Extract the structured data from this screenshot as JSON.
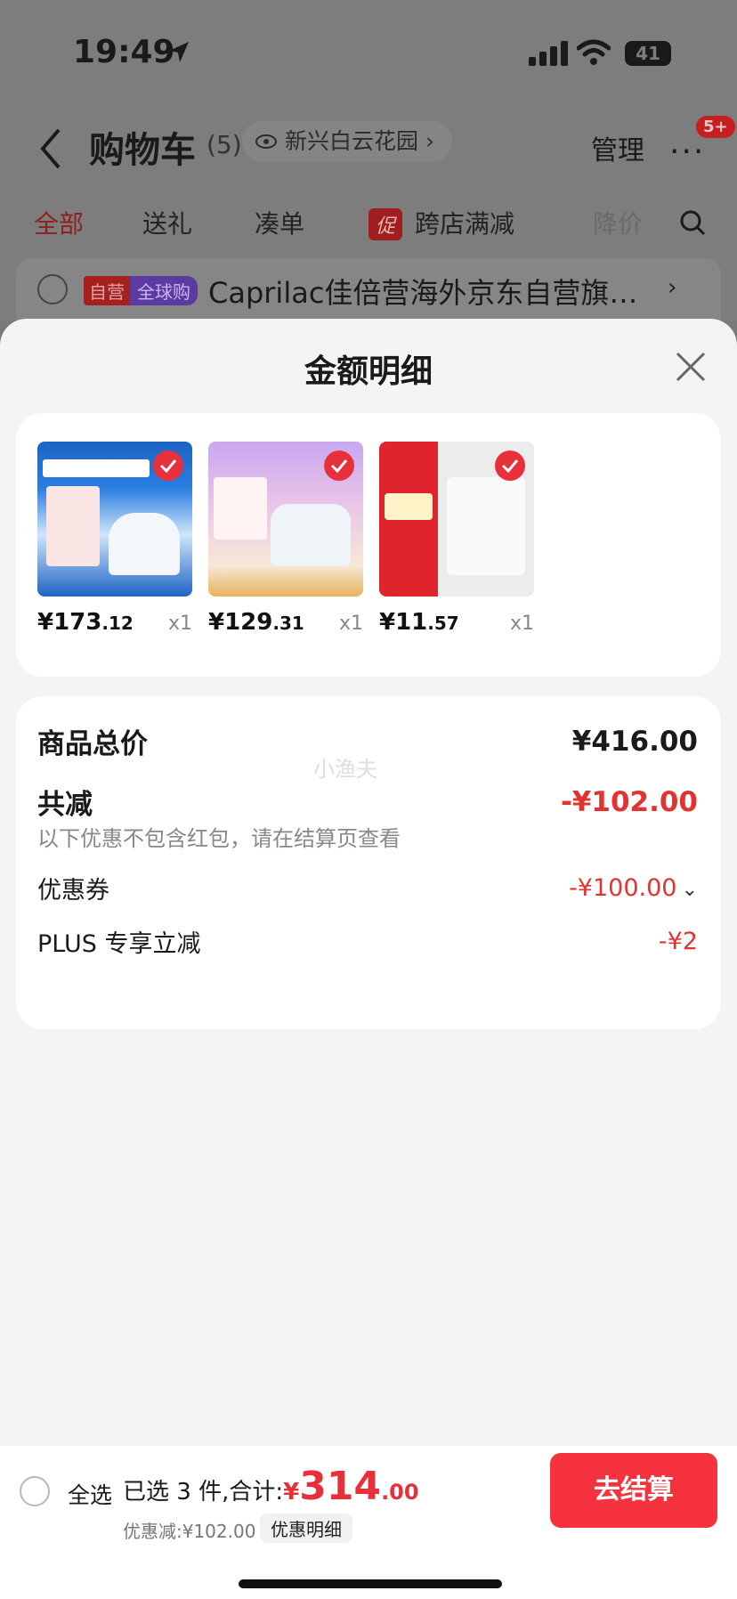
{
  "status_bar": {
    "time": "19:49",
    "battery": "41"
  },
  "header": {
    "title": "购物车",
    "count": "(5)",
    "address": "新兴白云花园",
    "manage": "管理",
    "more": "···",
    "badge": "5+"
  },
  "tabs": [
    "全部",
    "送礼",
    "凑单",
    "跨店满减",
    "降价"
  ],
  "promo_tag": "促",
  "shop": {
    "tag_self": "自营",
    "tag_global": "全球购",
    "name": "Caprilac佳倍营海外京东自营旗…",
    "chevron": "›"
  },
  "sheet": {
    "title": "金额明细",
    "products": [
      {
        "price_int": "¥173",
        "price_dec": ".12",
        "qty": "x1"
      },
      {
        "price_int": "¥129",
        "price_dec": ".31",
        "qty": "x1"
      },
      {
        "price_int": "¥11",
        "price_dec": ".57",
        "qty": "x1"
      }
    ],
    "detail": {
      "subtotal_label": "商品总价",
      "subtotal_value": "¥416.00",
      "watermark": "小渔夫",
      "reduce_label": "共减",
      "reduce_value": "-¥102.00",
      "note": "以下优惠不包含红包，请在结算页查看",
      "coupon_label": "优惠券",
      "coupon_value": "-¥100.00",
      "plus_label": "PLUS 专享立减",
      "plus_value": "-¥2"
    }
  },
  "bottom": {
    "select_all": "全选",
    "summary_label": "已选 3 件,合计:",
    "total_symbol": "¥",
    "total_int": "314",
    "total_dec": ".00",
    "discount_text": "优惠减:¥102.00",
    "discount_button": "优惠明细",
    "checkout": "去结算"
  },
  "colors": {
    "accent": "#f5323d",
    "discount_red": "#e23232"
  }
}
